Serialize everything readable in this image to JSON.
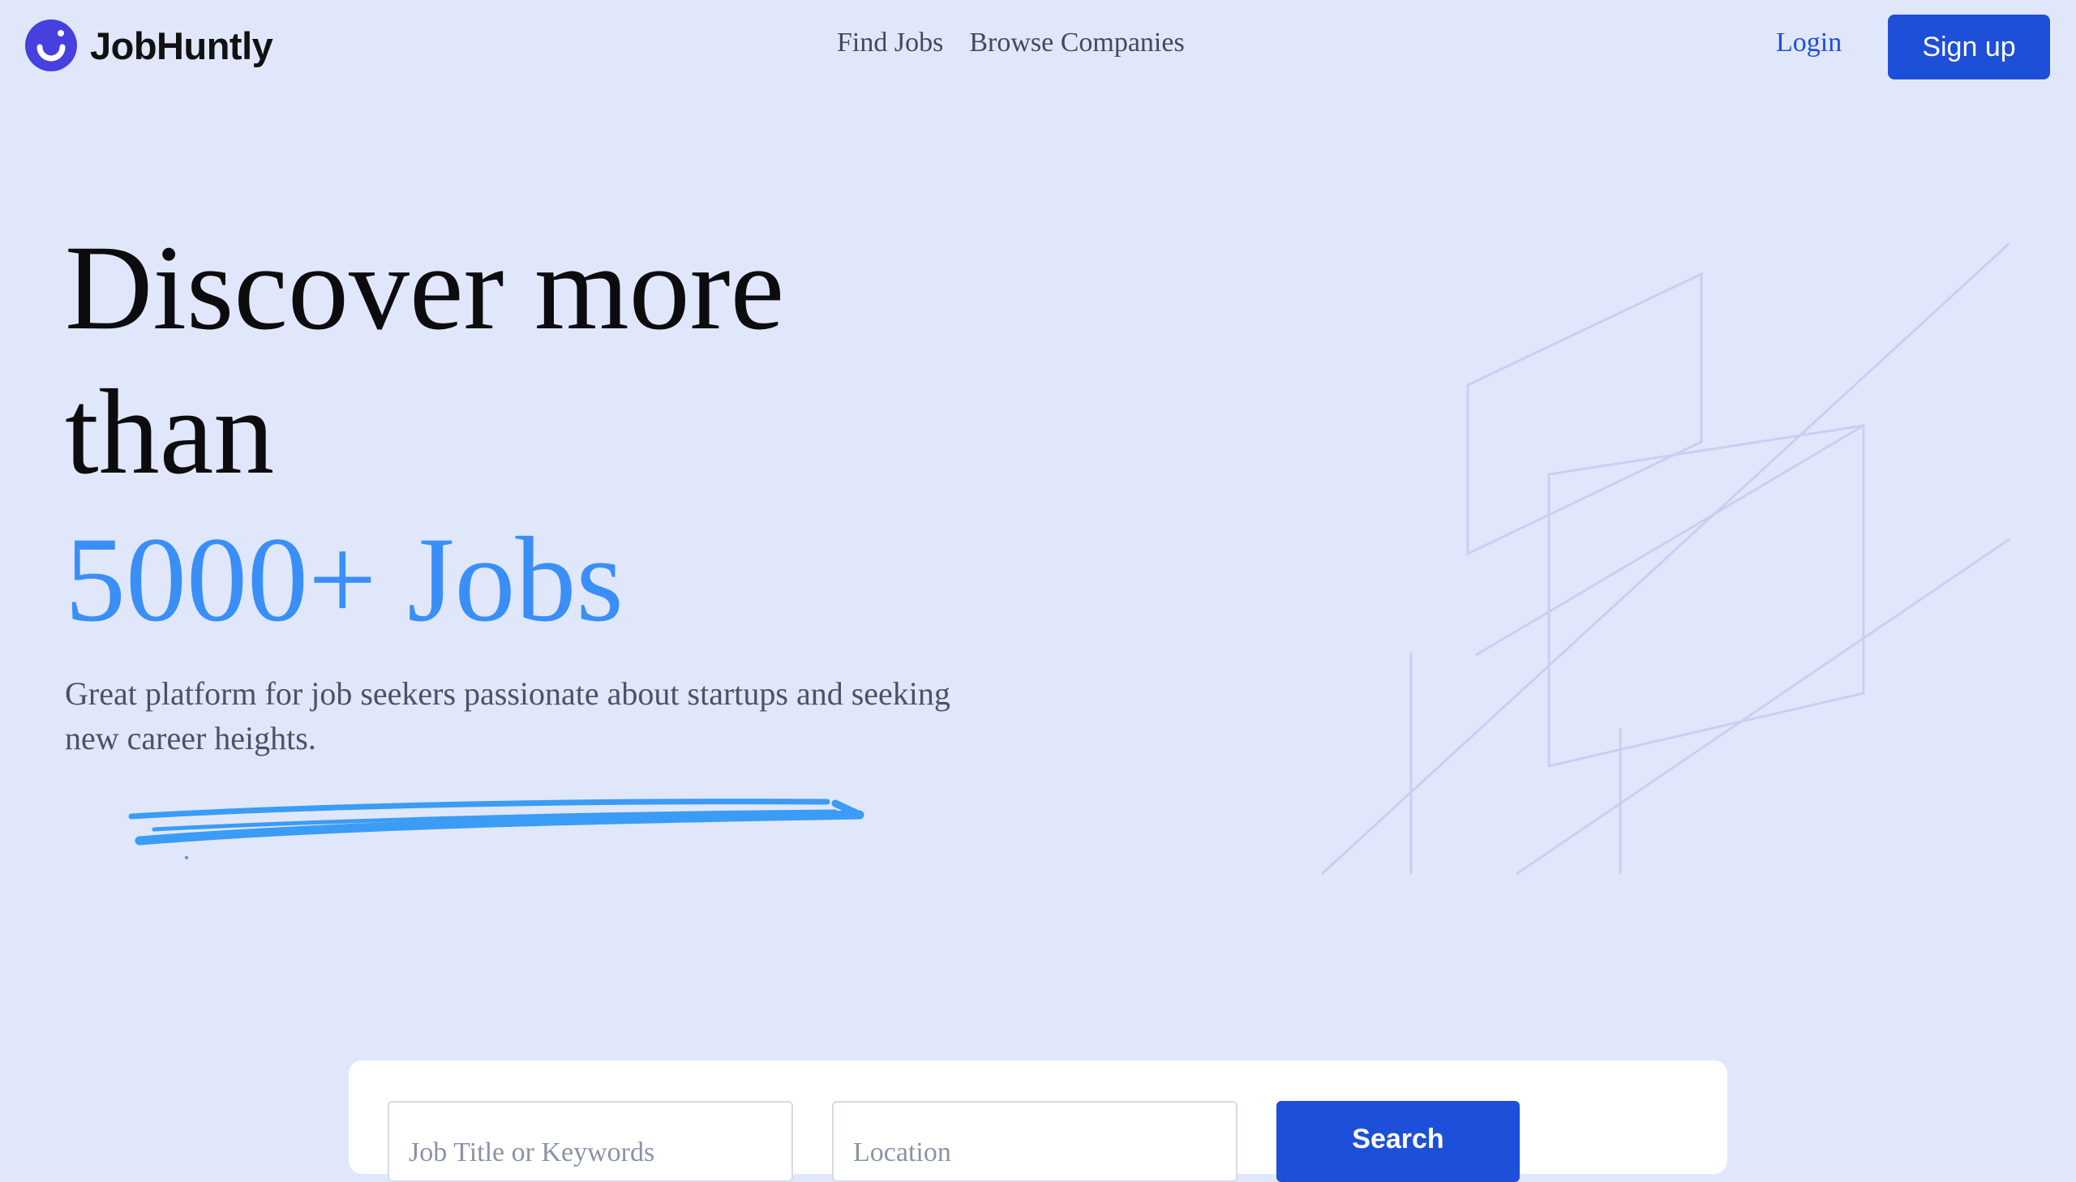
{
  "brand": {
    "name": "JobHuntly",
    "color": "#4640de"
  },
  "nav": {
    "find_jobs": "Find Jobs",
    "browse_companies": "Browse Companies"
  },
  "auth": {
    "login": "Login",
    "signup": "Sign up"
  },
  "hero": {
    "line1": "Discover more",
    "line2": "than",
    "highlight": "5000+ Jobs",
    "subtitle": "Great platform for job seekers passionate about startups and seeking new career heights."
  },
  "search": {
    "keyword_placeholder": "Job Title or Keywords",
    "location_placeholder": "Location",
    "button": "Search"
  },
  "colors": {
    "background": "#e1e7fb",
    "accent": "#1d4fd8",
    "highlight": "#3a8ff6"
  }
}
